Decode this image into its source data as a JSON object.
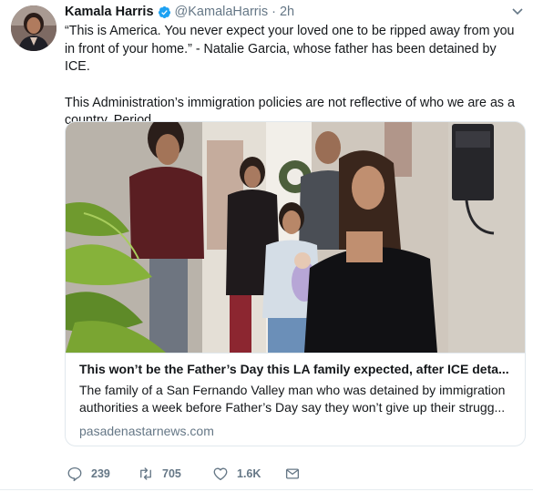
{
  "tweet": {
    "author_name": "Kamala Harris",
    "handle": "@KamalaHarris",
    "separator": "·",
    "time": "2h",
    "text_p1": "“This is America. You never expect your loved one to be ripped away from you in front of your home.” - Natalie Garcia, whose father has been detained by ICE.",
    "text_p2": "This Administration’s immigration policies are not reflective of who we are as a country. Period."
  },
  "card": {
    "title": "This won’t be the Father’s Day this LA family expected, after ICE deta...",
    "description": "The family of a San Fernando Valley man who was detained by immigration authorities a week before Father’s Day say they won’t give up their strugg...",
    "domain": "pasadenastarnews.com"
  },
  "actions": {
    "reply_count": "239",
    "retweet_count": "705",
    "like_count": "1.6K"
  },
  "colors": {
    "verified": "#1da1f2",
    "secondary_text": "#657786",
    "border": "#e1e8ed"
  }
}
